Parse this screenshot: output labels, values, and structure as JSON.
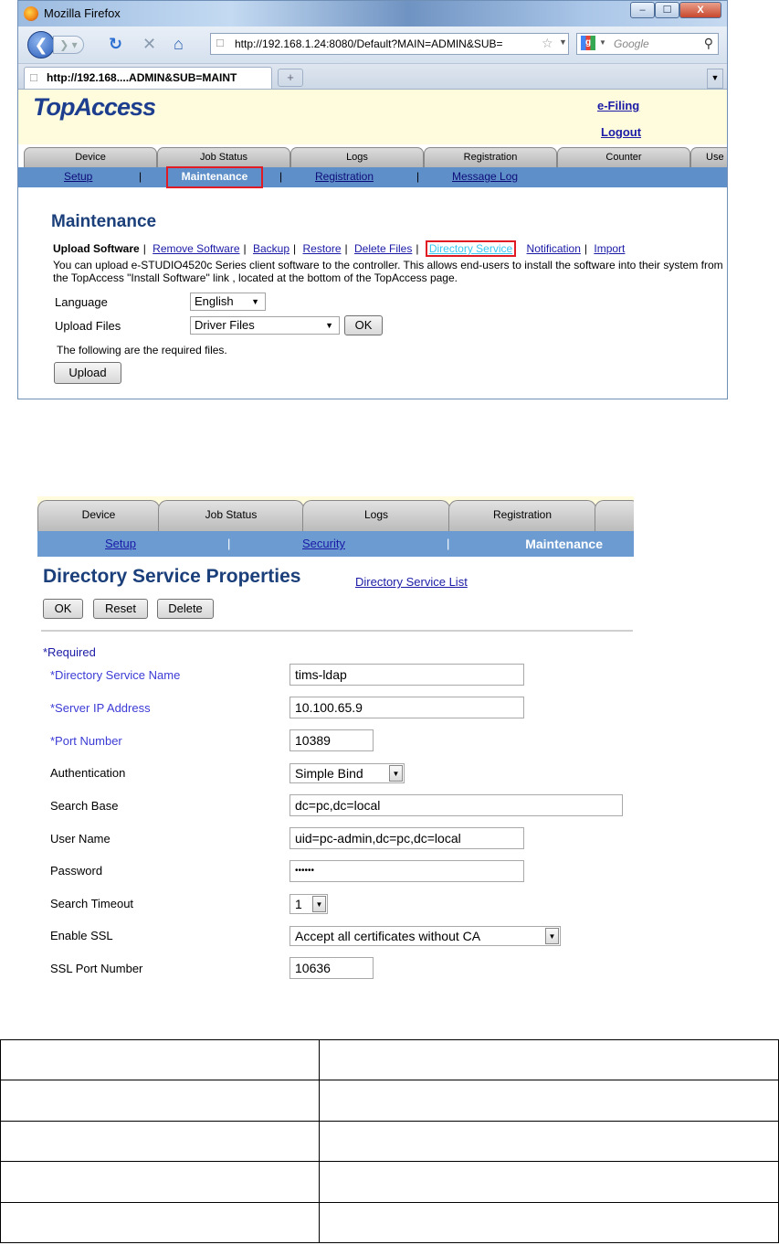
{
  "browser": {
    "title": "Mozilla Firefox",
    "url": "http://192.168.1.24:8080/Default?MAIN=ADMIN&SUB=",
    "tab_label": "http://192.168....ADMIN&SUB=MAINT",
    "search_placeholder": "Google",
    "controls": {
      "minimize": "–",
      "maximize": "☐",
      "close": "X"
    }
  },
  "page1": {
    "logo": "TopAccess",
    "efiling": "e-Filing",
    "logout": "Logout",
    "main_tabs": [
      "Device",
      "Job Status",
      "Logs",
      "Registration",
      "Counter",
      "Use"
    ],
    "sub_nav": [
      "Setup",
      "Maintenance",
      "Registration",
      "Message Log"
    ],
    "sub_nav_active": "Maintenance",
    "heading": "Maintenance",
    "sub_links": [
      "Upload Software",
      "Remove Software",
      "Backup",
      "Restore",
      "Delete Files",
      "Directory Service",
      "Notification",
      "Import"
    ],
    "description": "You can upload e-STUDIO4520c Series client software to the controller. This allows end-users to install the software into their system from the TopAccess \"Install Software\" link , located at the bottom of the TopAccess page.",
    "language_label": "Language",
    "language_value": "English",
    "upload_files_label": "Upload Files",
    "upload_files_value": "Driver Files",
    "ok_button": "OK",
    "required_files_note": "The following are the required files.",
    "upload_button": "Upload"
  },
  "page2": {
    "main_tabs": [
      "Device",
      "Job Status",
      "Logs",
      "Registration"
    ],
    "sub_nav": [
      "Setup",
      "Security"
    ],
    "sub_nav_active": "Maintenance",
    "title": "Directory Service Properties",
    "list_link": "Directory Service List",
    "buttons": {
      "ok": "OK",
      "reset": "Reset",
      "delete": "Delete"
    },
    "required_note": "*Required",
    "fields": {
      "ds_name": {
        "label": "*Directory Service Name",
        "value": "tims-ldap"
      },
      "server_ip": {
        "label": "*Server IP Address",
        "value": "10.100.65.9"
      },
      "port": {
        "label": "*Port Number",
        "value": "10389"
      },
      "auth": {
        "label": "Authentication",
        "value": "Simple Bind"
      },
      "search_base": {
        "label": "Search Base",
        "value": "dc=pc,dc=local"
      },
      "user_name": {
        "label": "User Name",
        "value": "uid=pc-admin,dc=pc,dc=local"
      },
      "password": {
        "label": "Password",
        "value": "••••••"
      },
      "search_timeout": {
        "label": "Search Timeout",
        "value": "1"
      },
      "enable_ssl": {
        "label": "Enable SSL",
        "value": "Accept all certificates without CA"
      },
      "ssl_port": {
        "label": "SSL Port Number",
        "value": "10636"
      }
    }
  },
  "bottom_table": {
    "rows": [
      [
        "",
        ""
      ],
      [
        "",
        ""
      ],
      [
        "",
        ""
      ],
      [
        "",
        ""
      ],
      [
        "",
        ""
      ]
    ]
  }
}
